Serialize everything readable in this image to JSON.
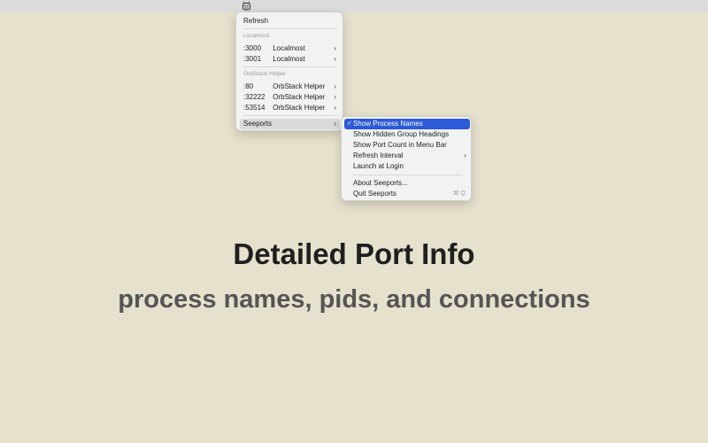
{
  "menubar": {
    "icon": "seeports-app-icon"
  },
  "main_menu": {
    "refresh": "Refresh",
    "groups": [
      {
        "heading": "Localmost",
        "items": [
          {
            "port": ":3000",
            "name": "Localmost"
          },
          {
            "port": ":3001",
            "name": "Localmost"
          }
        ]
      },
      {
        "heading": "OrbStack Helper",
        "items": [
          {
            "port": ":80",
            "name": "OrbStack Helper"
          },
          {
            "port": ":32222",
            "name": "OrbStack Helper"
          },
          {
            "port": ":53514",
            "name": "OrbStack Helper"
          }
        ]
      }
    ],
    "seeports": "Seeports"
  },
  "sub_menu": {
    "show_process_names": "Show Process Names",
    "show_process_names_checked": "✓",
    "show_hidden_group_headings": "Show Hidden Group Headings",
    "show_port_count": "Show Port Count in Menu Bar",
    "refresh_interval": "Refresh Interval",
    "launch_at_login": "Launch at Login",
    "about": "About Seeports...",
    "quit": "Quit Seeports",
    "quit_shortcut": "⌘ Q"
  },
  "headline": "Detailed Port Info",
  "subheadline": "process names, pids, and connections",
  "colors": {
    "background": "#e6e1cc",
    "highlight": "#2c5ad8"
  }
}
